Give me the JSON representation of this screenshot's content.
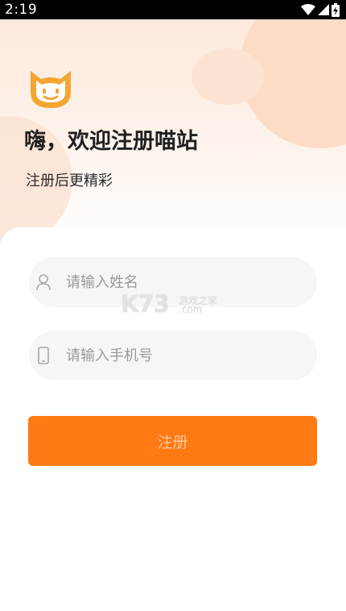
{
  "status_bar": {
    "time": "2:19",
    "icons": [
      "wifi-icon",
      "signal-icon",
      "battery-charging-icon"
    ]
  },
  "app": {
    "logo_icon": "cat-face-logo",
    "headline": "嗨，欢迎注册喵站",
    "subtitle": "注册后更精彩"
  },
  "form": {
    "name_placeholder": "请输入姓名",
    "name_icon": "user-icon",
    "phone_placeholder": "请输入手机号",
    "phone_icon": "phone-icon",
    "submit_label": "注册"
  },
  "watermark": {
    "brand": "K73",
    "line1": "游戏之家",
    "line2": ".com"
  },
  "colors": {
    "accent": "#ff7a12",
    "logo_orange": "#f5a532",
    "hero_blob": "#fcdcc6",
    "input_bg": "#f6f6f6",
    "placeholder": "#9a9a9a"
  }
}
